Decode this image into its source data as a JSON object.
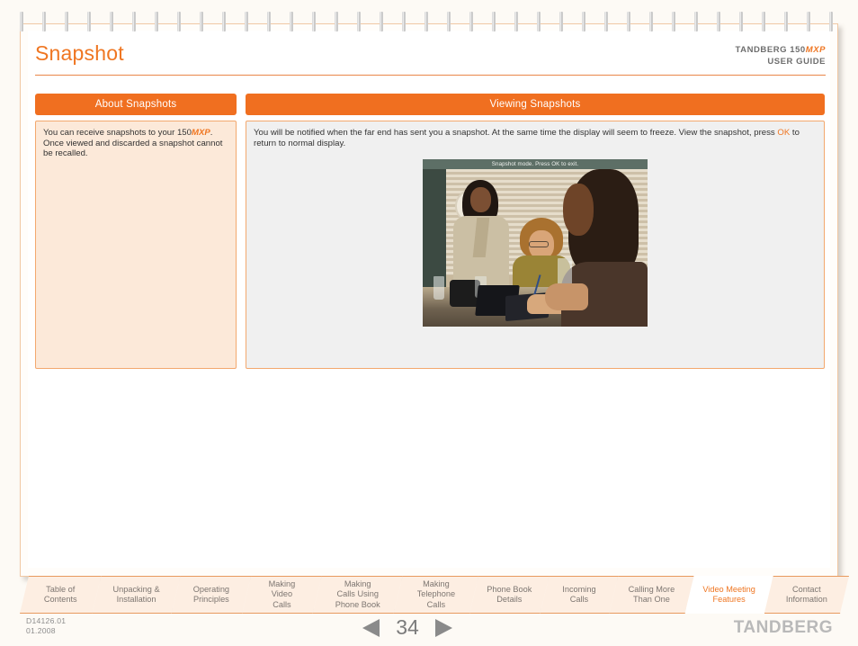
{
  "header": {
    "title": "Snapshot",
    "product_line1_prefix": "TANDBERG 150",
    "product_line1_suffix": "MXP",
    "product_line2": "USER GUIDE"
  },
  "columns": {
    "left": {
      "heading": "About Snapshots",
      "text_part1": "You can receive snapshots to your 150",
      "text_emphasis": "MXP",
      "text_part2": ". Once viewed and discarded a snapshot cannot be recalled."
    },
    "right": {
      "heading": "Viewing Snapshots",
      "text_part1": "You will be notified when the far end has sent you a snapshot. At the same time the display will seem to freeze. View the snapshot, press ",
      "text_emphasis": "OK",
      "text_part2": " to return to normal display.",
      "photo_caption": "Snapshot mode. Press OK to exit."
    }
  },
  "tabs": [
    {
      "label": "Table of\nContents",
      "active": false
    },
    {
      "label": "Unpacking &\nInstallation",
      "active": false
    },
    {
      "label": "Operating\nPrinciples",
      "active": false
    },
    {
      "label": "Making\nVideo\nCalls",
      "active": false
    },
    {
      "label": "Making\nCalls Using\nPhone Book",
      "active": false
    },
    {
      "label": "Making\nTelephone\nCalls",
      "active": false
    },
    {
      "label": "Phone Book\nDetails",
      "active": false
    },
    {
      "label": "Incoming\nCalls",
      "active": false
    },
    {
      "label": "Calling More\nThan One",
      "active": false
    },
    {
      "label": "Video Meeting\nFeatures",
      "active": true
    },
    {
      "label": "Contact\nInformation",
      "active": false
    }
  ],
  "footer": {
    "doc_code_line1": "D14126.01",
    "doc_code_line2": "01.2008",
    "page_number": "34",
    "brand": "TANDBERG"
  },
  "colors": {
    "accent_orange": "#ef7622",
    "heading_bar": "#f06f20",
    "panel_peach": "#fce9d9",
    "panel_gray": "#f0f0f0",
    "page_bg": "#fdfaf5",
    "tab_bg": "#fdeee2",
    "muted_gray": "#8a8a8a"
  }
}
